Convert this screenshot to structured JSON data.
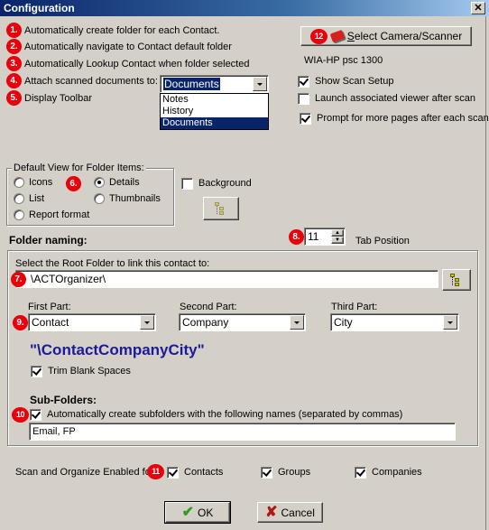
{
  "window": {
    "title": "Configuration",
    "close_label": "✕"
  },
  "options": [
    {
      "badge": "1.",
      "label": "Automatically create folder for each Contact."
    },
    {
      "badge": "2.",
      "label": "Automatically navigate to Contact default folder"
    },
    {
      "badge": "3.",
      "label": "Automatically Lookup Contact when folder selected"
    },
    {
      "badge": "4.",
      "label": "Attach scanned documents to:"
    },
    {
      "badge": "5.",
      "label": "Display Toolbar"
    }
  ],
  "attach_combo": {
    "value": "Documents",
    "options": [
      "Notes",
      "History",
      "Documents"
    ],
    "selected_index": 2
  },
  "scanner": {
    "badge": "12",
    "button_label_underlined": "S",
    "button_label_rest": "elect Camera/Scanner",
    "device_name": "WIA-HP psc 1300",
    "checkboxes": [
      {
        "label": "Show Scan Setup",
        "checked": true
      },
      {
        "label": "Launch associated viewer after scan",
        "checked": false
      },
      {
        "label": "Prompt for more pages after each scan",
        "checked": true
      }
    ]
  },
  "default_view": {
    "legend": "Default View for Folder Items:",
    "badge": "6.",
    "radios": [
      {
        "label": "Icons",
        "checked": false
      },
      {
        "label": "List",
        "checked": false
      },
      {
        "label": "Report format",
        "checked": false
      },
      {
        "label": "Details",
        "checked": true
      },
      {
        "label": "Thumbnails",
        "checked": false
      }
    ]
  },
  "background": {
    "label": "Background",
    "checked": false
  },
  "folder_naming": {
    "heading": "Folder naming:",
    "tab_position": {
      "badge": "8.",
      "value": "11",
      "label": "Tab Position"
    },
    "root_folder_label": "Select the Root Folder to link this contact to:",
    "root_folder_badge": "7.",
    "root_folder_value": "\\ACTOrganizer\\",
    "parts_badge": "9.",
    "parts": [
      {
        "label": "First Part:",
        "value": "Contact"
      },
      {
        "label": "Second Part:",
        "value": "Company"
      },
      {
        "label": "Third Part:",
        "value": "City"
      }
    ],
    "preview": "\"\\ContactCompanyCity\"",
    "preview_color": "#1a1a9a",
    "trim_blank": {
      "label": "Trim Blank Spaces",
      "checked": true
    },
    "subfolders": {
      "heading": "Sub-Folders:",
      "badge": "10",
      "checkbox_label": "Automatically create subfolders with the following names (separated by commas)",
      "checked": true,
      "value": "Email, FP"
    }
  },
  "scan_enabled": {
    "label": "Scan and Organize Enabled for",
    "badge": "11",
    "items": [
      {
        "label": "Contacts",
        "checked": true
      },
      {
        "label": "Groups",
        "checked": true
      },
      {
        "label": "Companies",
        "checked": true
      }
    ]
  },
  "footer": {
    "ok_label": "OK",
    "cancel_label": "Cancel"
  },
  "colors": {
    "badge": "#e8000a",
    "selection": "#0a246a",
    "ok_check": "#2e9a1e",
    "cancel_x": "#b01818"
  }
}
